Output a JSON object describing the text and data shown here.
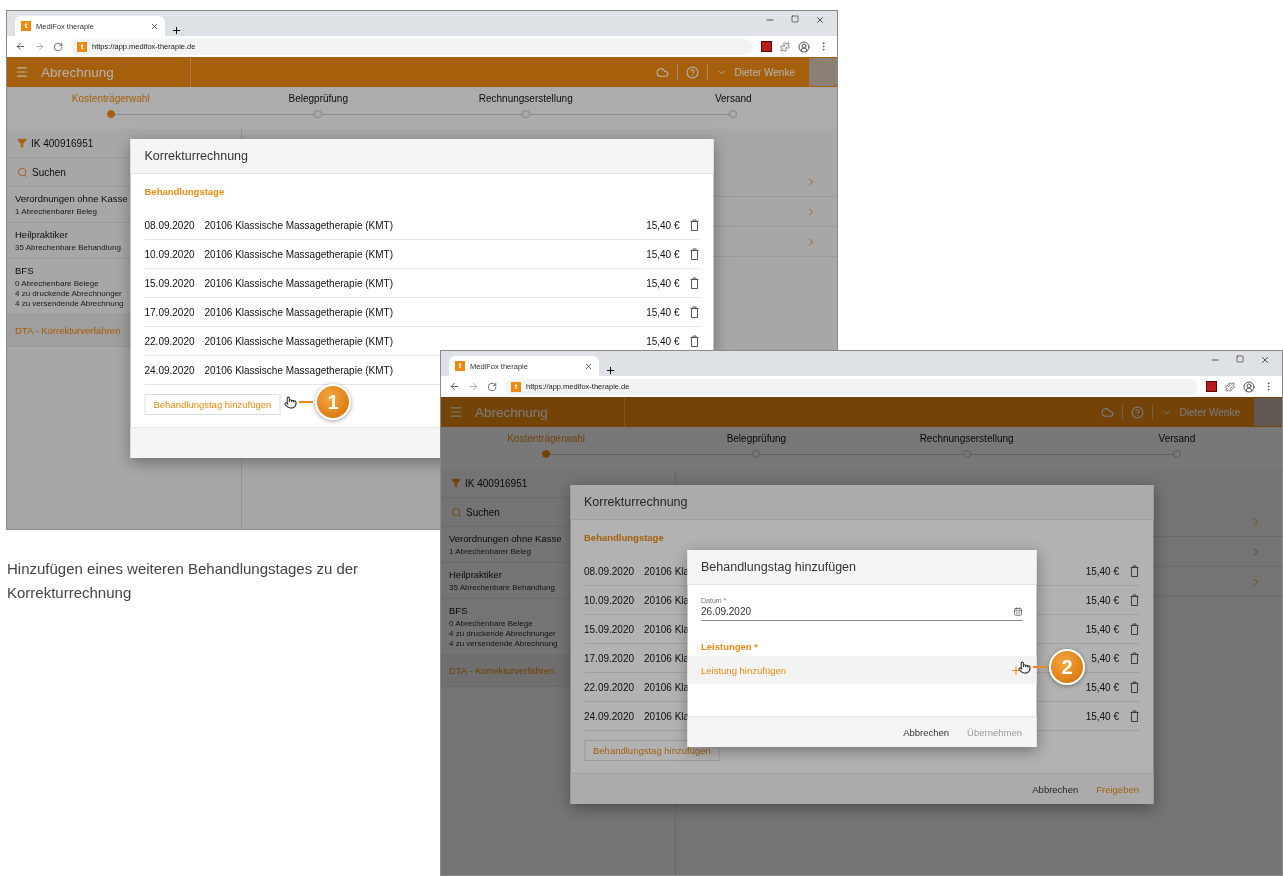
{
  "windows": [
    {
      "browser": {
        "tab_icon": "t",
        "tab_title": "MediFox therapie",
        "url_icon": "t",
        "url": "https://app.medifox-therapie.de"
      },
      "app": {
        "title": "Abrechnung",
        "user": "Dieter Wenke",
        "steps": [
          {
            "label": "Kostenträgerwahl",
            "selected": true
          },
          {
            "label": "Belegprüfung",
            "selected": false
          },
          {
            "label": "Rechnungserstellung",
            "selected": false
          },
          {
            "label": "Versand",
            "selected": false
          }
        ],
        "filter": "IK 400916951",
        "search": "Suchen",
        "groups": [
          {
            "title": "Verordnungen ohne Kasse",
            "lines": [
              "1 Abrechenbarer Beleg"
            ],
            "selected": false
          },
          {
            "title": "Heilpraktiker",
            "lines": [
              "35 Abrechenbare Behandlung"
            ],
            "selected": false
          },
          {
            "title": "BFS",
            "lines": [
              "0 Abrechenbare Belege",
              "4 zu druckende Abrechnunger",
              "4 zu versendende Abrechnung"
            ],
            "selected": false
          },
          {
            "title": "DTA - Korrekturverfahren",
            "selected": true
          }
        ]
      },
      "dialog": {
        "title": "Korrekturrechnung",
        "section": "Behandlungstage",
        "rows": [
          {
            "date": "08.09.2020",
            "service": "20106 Klassische Massagetherapie (KMT)",
            "price": "15,40 €"
          },
          {
            "date": "10.09.2020",
            "service": "20106 Klassische Massagetherapie (KMT)",
            "price": "15,40 €"
          },
          {
            "date": "15.09.2020",
            "service": "20106 Klassische Massagetherapie (KMT)",
            "price": "15,40 €"
          },
          {
            "date": "17.09.2020",
            "service": "20106 Klassische Massagetherapie (KMT)",
            "price": "15,40 €"
          },
          {
            "date": "22.09.2020",
            "service": "20106 Klassische Massagetherapie (KMT)",
            "price": "15,40 €"
          },
          {
            "date": "24.09.2020",
            "service": "20106 Klassische Massagetherapie (KMT)"
          }
        ],
        "add_button": "Behandlungstag hinzufügen"
      },
      "callout": "1"
    },
    {
      "browser": {
        "tab_icon": "t",
        "tab_title": "MediFox therapie",
        "url_icon": "t",
        "url": "https://app.medifox-therapie.de"
      },
      "app": {
        "title": "Abrechnung",
        "user": "Dieter Wenke",
        "steps": [
          {
            "label": "Kostenträgerwahl",
            "selected": true
          },
          {
            "label": "Belegprüfung",
            "selected": false
          },
          {
            "label": "Rechnungserstellung",
            "selected": false
          },
          {
            "label": "Versand",
            "selected": false
          }
        ],
        "filter": "IK 400916951",
        "search": "Suchen",
        "groups": [
          {
            "title": "Verordnungen ohne Kasse",
            "lines": [
              "1 Abrechenbarer Beleg"
            ],
            "selected": false
          },
          {
            "title": "Heilpraktiker",
            "lines": [
              "35 Abrechenbare Behandlung"
            ],
            "selected": false
          },
          {
            "title": "BFS",
            "lines": [
              "0 Abrechenbare Belege",
              "4 zu druckende Abrechnunger",
              "4 zu versendende Abrechnung"
            ],
            "selected": false
          },
          {
            "title": "DTA - Korrekturverfahren",
            "selected": true
          }
        ]
      },
      "dialog": {
        "title": "Korrekturrechnung",
        "section": "Behandlungstage",
        "rows": [
          {
            "date": "08.09.2020",
            "service": "20106 Kla",
            "price": "15,40 €"
          },
          {
            "date": "10.09.2020",
            "service": "20106 Kla",
            "price": "15,40 €"
          },
          {
            "date": "15.09.2020",
            "service": "20106 Kla",
            "price": "15,40 €"
          },
          {
            "date": "17.09.2020",
            "service": "20106 Kla",
            "price": "5,40 €"
          },
          {
            "date": "22.09.2020",
            "service": "20106 Kla",
            "price": "15,40 €"
          },
          {
            "date": "24.09.2020",
            "service": "20106 Kla",
            "price": "15,40 €"
          }
        ],
        "add_button": "Behandlungstag hinzufügen",
        "buttons": [
          {
            "label": "Abbrechen",
            "primary": false
          },
          {
            "label": "Freigeben",
            "primary": true
          }
        ]
      },
      "subdialog": {
        "title": "Behandlungstag hinzufügen",
        "field_label": "Datum *",
        "field_value": "26.09.2020",
        "section": "Leistungen *",
        "add_label": "Leistung hinzufügen",
        "buttons": [
          {
            "label": "Abbrechen",
            "disabled": false
          },
          {
            "label": "Übernehmen",
            "disabled": true
          }
        ]
      },
      "callout": "2"
    }
  ],
  "caption": "Hinzufügen eines weiteren Behandlungstages zu der Korrekturrechnung"
}
